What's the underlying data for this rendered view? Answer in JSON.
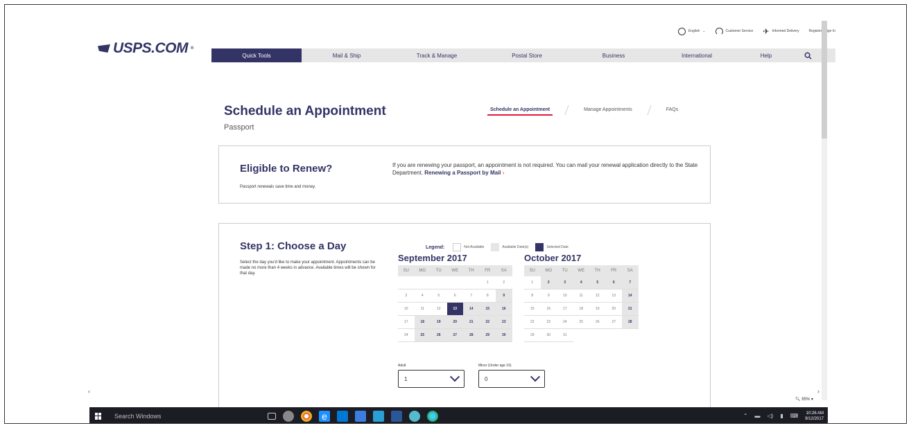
{
  "util": {
    "language": "English",
    "customer_service": "Customer Service",
    "informed_delivery": "Informed Delivery",
    "register": "Register / Sign In"
  },
  "logo": "USPS.COM",
  "nav": [
    "Quick Tools",
    "Mail & Ship",
    "Track & Manage",
    "Postal Store",
    "Business",
    "International",
    "Help"
  ],
  "page": {
    "title": "Schedule an Appointment",
    "subtitle": "Passport"
  },
  "subnav": [
    "Schedule an Appointment",
    "Manage Appointments",
    "FAQs"
  ],
  "renew": {
    "heading": "Eligible to Renew?",
    "sub": "Passport renewals save time and money.",
    "text": "If you are renewing your passport, an appointment is not required. You can mail your renewal application directly to the State Department.",
    "link": "Renewing a Passport by Mail",
    "chevron": "›"
  },
  "step1": {
    "heading": "Step 1: Choose a Day",
    "desc": "Select the day you'd like to make your appointment. Appointments can be made no more than 4 weeks in advance. Available times will be shown for that day."
  },
  "legend": {
    "label": "Legend:",
    "not_available": "Not Available",
    "available": "Available Date(s)",
    "selected": "Selected Date"
  },
  "days_of_week": [
    "SU",
    "MO",
    "TU",
    "WE",
    "TH",
    "FR",
    "SA"
  ],
  "calendars": [
    {
      "title": "September 2017",
      "offset": 5,
      "days": 30,
      "available": [
        9,
        14,
        15,
        16,
        18,
        19,
        20,
        21,
        22,
        23,
        25,
        26,
        27,
        28,
        29,
        30
      ],
      "selected": 13
    },
    {
      "title": "October 2017",
      "offset": 0,
      "days": 31,
      "available": [
        2,
        3,
        4,
        5,
        6,
        7,
        14,
        21,
        28
      ],
      "selected": null
    }
  ],
  "adult": {
    "label": "Adult",
    "value": "1"
  },
  "minor": {
    "label": "Minor (Under age 16)",
    "value": "0"
  },
  "zoom": "95%",
  "taskbar": {
    "search": "Search Windows",
    "time": "10:26 AM",
    "date": "9/12/2017"
  },
  "colors": {
    "brand": "#333366",
    "accent": "#e31937",
    "available_bg": "#e6e6e6"
  }
}
